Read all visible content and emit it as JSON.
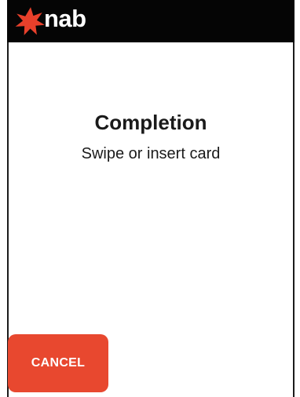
{
  "header": {
    "brand": "nab",
    "logo_icon": "nab-star-logo-icon",
    "background_color": "#050505",
    "logo_color": "#e8402b"
  },
  "main": {
    "title": "Completion",
    "message": "Swipe or insert card"
  },
  "actions": {
    "cancel_label": "CANCEL",
    "cancel_color": "#e8482f"
  }
}
